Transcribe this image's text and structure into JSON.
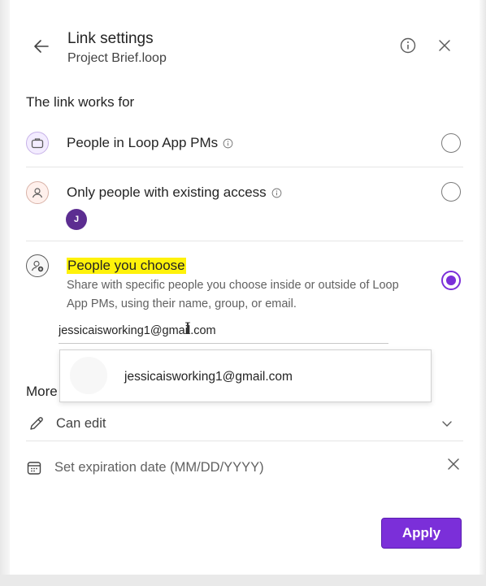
{
  "header": {
    "title": "Link settings",
    "subtitle": "Project Brief.loop",
    "icons": {
      "back": "arrow-left-icon",
      "info": "info-icon",
      "close": "close-icon"
    }
  },
  "link_works_for": {
    "heading": "The link works for",
    "options": [
      {
        "label": "People in Loop App PMs",
        "icon": "briefcase-icon",
        "selected": false,
        "has_info": true
      },
      {
        "label": "Only people with existing access",
        "icon": "person-icon",
        "selected": false,
        "has_info": true,
        "avatar_initial": "J"
      },
      {
        "label": "People you choose",
        "icon": "person-add-icon",
        "selected": true,
        "highlighted": true,
        "description": "Share with specific people you choose inside or outside of Loop App PMs, using their name, group, or email."
      }
    ]
  },
  "email_input": {
    "value": "jessicaisworking1@gmail.com"
  },
  "suggestion_dropdown": {
    "items": [
      {
        "email": "jessicaisworking1@gmail.com"
      }
    ]
  },
  "more_settings": {
    "heading": "More",
    "permission": {
      "label": "Can edit",
      "icon": "pencil-icon"
    },
    "expiration": {
      "label": "Set expiration date (MM/DD/YYYY)",
      "icon": "calendar-icon"
    }
  },
  "footer": {
    "apply_label": "Apply"
  },
  "colors": {
    "accent": "#7b2fd9",
    "highlight": "#fff20a",
    "avatar": "#5c2d91"
  }
}
